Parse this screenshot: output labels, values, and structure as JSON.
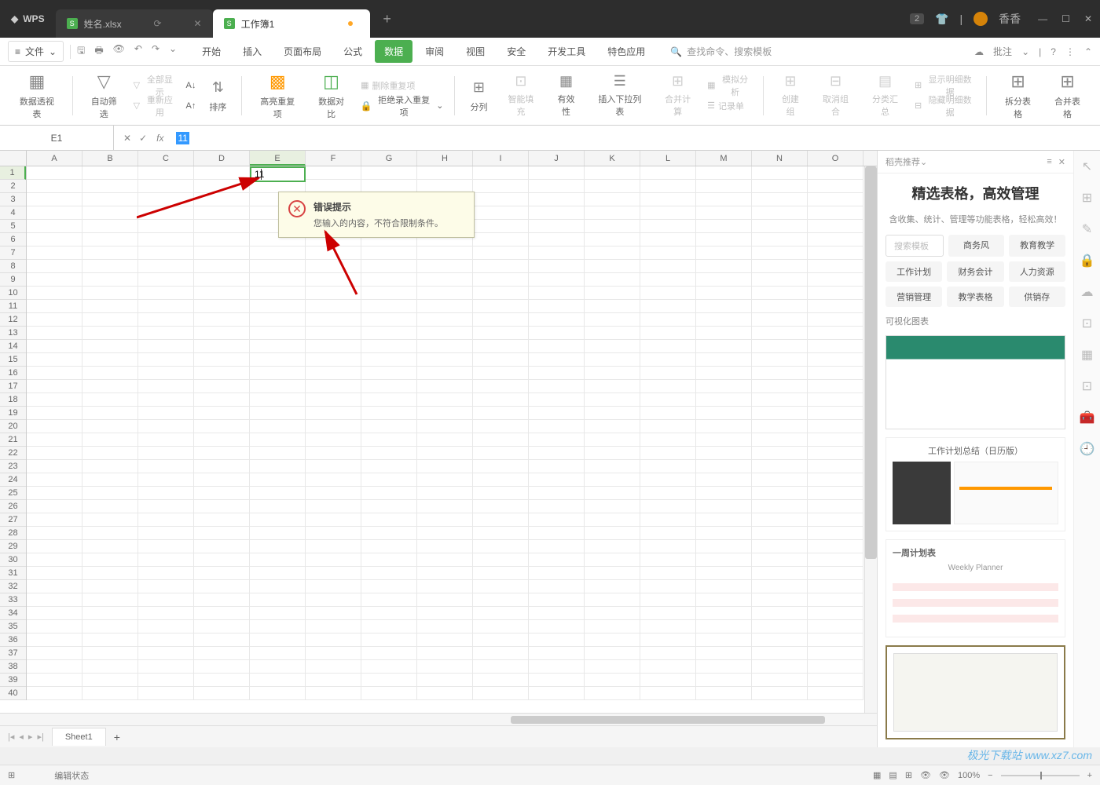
{
  "titlebar": {
    "logo": "WPS",
    "tabs": [
      {
        "icon": "S",
        "label": "姓名.xlsx"
      },
      {
        "icon": "S",
        "label": "工作簿1"
      }
    ],
    "badge": "2",
    "user": "香香"
  },
  "menubar": {
    "file": "文件",
    "tabs": [
      "开始",
      "插入",
      "页面布局",
      "公式",
      "数据",
      "审阅",
      "视图",
      "安全",
      "开发工具",
      "特色应用"
    ],
    "active_tab": "数据",
    "search_placeholder": "查找命令、搜索模板",
    "annotate": "批注"
  },
  "ribbon": {
    "pivot": "数据透视表",
    "autofilter": "自动筛选",
    "showall": "全部显示",
    "reapply": "重新应用",
    "sort": "排序",
    "highlight_dup": "高亮重复项",
    "data_compare": "数据对比",
    "del_dup": "删除重复项",
    "reject_input": "拒绝录入重复项",
    "split_col": "分列",
    "smart_fill": "智能填充",
    "validity": "有效性",
    "dropdown": "插入下拉列表",
    "consolidate": "合并计算",
    "simulate": "模拟分析",
    "record": "记录单",
    "group_create": "创建组",
    "group_ungroup": "取消组合",
    "subtotal": "分类汇总",
    "show_detail": "显示明细数据",
    "hide_detail": "隐藏明细数据",
    "split_table": "拆分表格",
    "merge_table": "合并表格"
  },
  "formulabar": {
    "cell_ref": "E1",
    "value": "11"
  },
  "grid": {
    "columns": [
      "A",
      "B",
      "C",
      "D",
      "E",
      "F",
      "G",
      "H",
      "I",
      "J",
      "K",
      "L",
      "M",
      "N",
      "O"
    ],
    "active_col": "E",
    "active_row": 1,
    "active_cell_value": "11",
    "row_count": 40
  },
  "error_tip": {
    "title": "错误提示",
    "message": "您输入的内容，不符合限制条件。"
  },
  "sheet_tabs": {
    "active": "Sheet1"
  },
  "rpanel": {
    "header": "稻壳推荐",
    "title": "精选表格，高效管理",
    "subtitle": "含收集、统计、管理等功能表格，轻松高效！",
    "search_placeholder": "搜索模板",
    "tags": [
      "商务风",
      "教育教学",
      "工作计划",
      "财务会计",
      "人力资源",
      "营销管理",
      "教学表格",
      "供销存"
    ],
    "section": "可视化图表",
    "thumb2_title": "工作计划总结（日历版）",
    "thumb3_title": "一周计划表",
    "thumb3_sub": "Weekly Planner"
  },
  "statusbar": {
    "mode": "编辑状态",
    "zoom": "100%"
  },
  "watermark": "极光下载站 www.xz7.com"
}
